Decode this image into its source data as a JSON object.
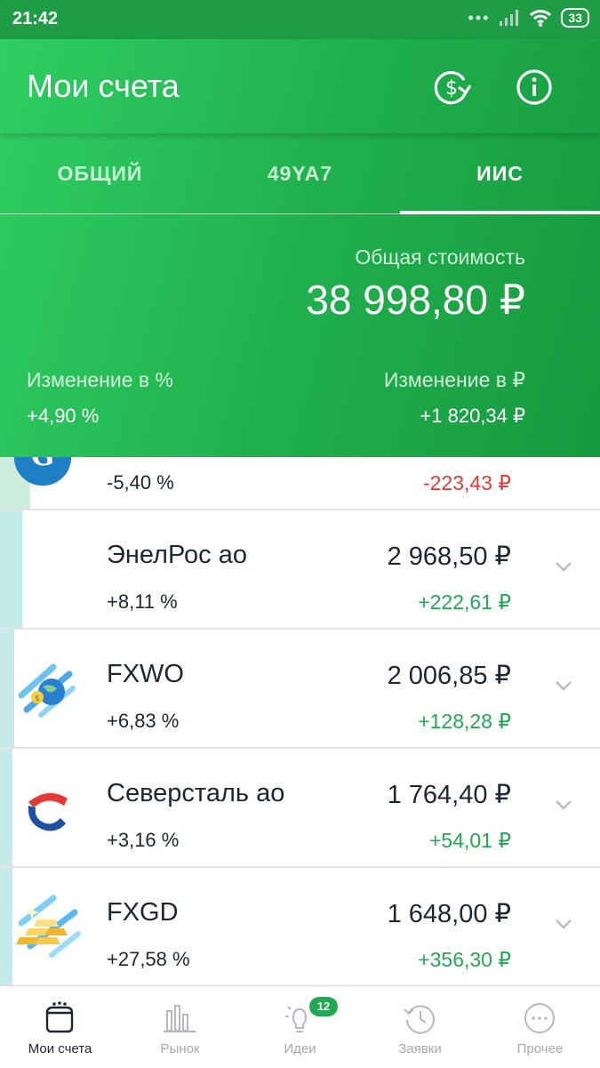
{
  "status_bar": {
    "time": "21:42",
    "battery": "33"
  },
  "header": {
    "title": "Мои счета"
  },
  "tabs": [
    {
      "label": "ОБЩИЙ",
      "active": false
    },
    {
      "label": "49YA7",
      "active": false
    },
    {
      "label": "ИИС",
      "active": true
    }
  ],
  "summary": {
    "total_label": "Общая стоимость",
    "total_value": "38 998,80 ₽",
    "change_pct_label": "Изменение в  %",
    "change_pct_value": "+4,90  %",
    "change_rub_label": "Изменение в ₽",
    "change_rub_value": "+1 820,34 ₽"
  },
  "positions": [
    {
      "name": "",
      "pct": "-5,40  %",
      "price": "",
      "delta": "-223,43 ₽",
      "direction": "neg",
      "bar_color": "#cdeede",
      "icon": "g-circle-logo"
    },
    {
      "name": "ЭнелРос ао",
      "pct": "+8,11  %",
      "price": "2 968,50 ₽",
      "delta": "+222,61 ₽",
      "direction": "pos",
      "bar_color": "#c4ebe8",
      "icon": ""
    },
    {
      "name": "FXWO",
      "pct": "+6,83  %",
      "price": "2 006,85 ₽",
      "delta": "+128,28 ₽",
      "direction": "pos",
      "bar_color": "#c4ebe8",
      "icon": "globe-money-logo"
    },
    {
      "name": "Северсталь ао",
      "pct": "+3,16  %",
      "price": "1 764,40 ₽",
      "delta": "+54,01 ₽",
      "direction": "pos",
      "bar_color": "#c4ebe8",
      "icon": "severstal-logo"
    },
    {
      "name": "FXGD",
      "pct": "+27,58  %",
      "price": "1 648,00 ₽",
      "delta": "+356,30 ₽",
      "direction": "pos",
      "bar_color": "#c4ebe8",
      "icon": "gold-bars-logo"
    }
  ],
  "bottom_nav": [
    {
      "label": "Мои счета",
      "icon": "wallet-icon",
      "active": true
    },
    {
      "label": "Рынок",
      "icon": "bar-chart-icon",
      "active": false
    },
    {
      "label": "Идеи",
      "icon": "lightbulb-icon",
      "active": false,
      "badge": "12"
    },
    {
      "label": "Заявки",
      "icon": "history-clock-icon",
      "active": false
    },
    {
      "label": "Прочее",
      "icon": "more-dots-icon",
      "active": false
    }
  ],
  "colors": {
    "brand_green": "#21a853",
    "negative": "#e53935",
    "text_dark": "#1e2633"
  }
}
